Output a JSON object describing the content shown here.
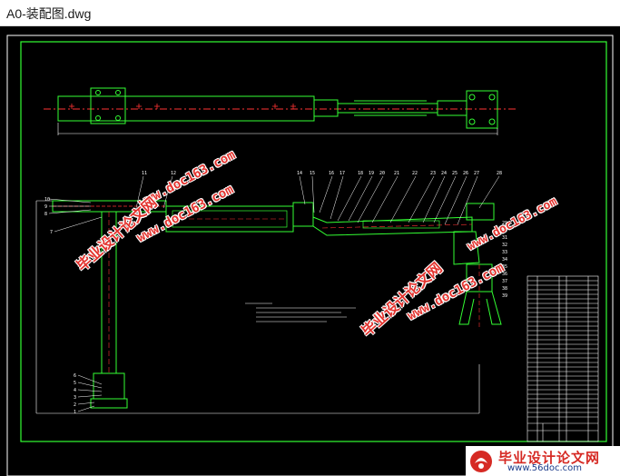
{
  "window": {
    "title": "A0-装配图.dwg"
  },
  "drawing": {
    "background": "#000000",
    "frame_color": "#ffffff",
    "border_color": "#33ff33",
    "part_color": "#33ff33",
    "centerline_color": "#ff3333",
    "hatch_color": "#ff3333",
    "text_color": "#ffffff",
    "balloon_numbers_top": [
      "11",
      "12",
      "14",
      "15",
      "16",
      "17",
      "18",
      "19",
      "20",
      "21",
      "22",
      "23",
      "24",
      "25",
      "26",
      "27",
      "28"
    ],
    "balloon_numbers_right": [
      "29",
      "30",
      "31",
      "32",
      "33",
      "34",
      "35",
      "36",
      "37",
      "38",
      "39"
    ],
    "balloon_numbers_left": [
      "10",
      "9",
      "8",
      "7",
      "6",
      "5",
      "4",
      "3",
      "2",
      "1"
    ]
  },
  "watermarks": [
    {
      "text": "www.doc163.com",
      "kind": "url"
    },
    {
      "text": "毕业设计论文网",
      "kind": "cn"
    },
    {
      "text": "毕业设计论文网",
      "kind": "cn"
    },
    {
      "text": "www.doc163.com",
      "kind": "url"
    },
    {
      "text": "www.doc163.com",
      "kind": "url"
    },
    {
      "text": "www.doc163.com",
      "kind": "url"
    }
  ],
  "logo": {
    "name": "毕业设计论文网",
    "url": "www.56doc.com"
  }
}
